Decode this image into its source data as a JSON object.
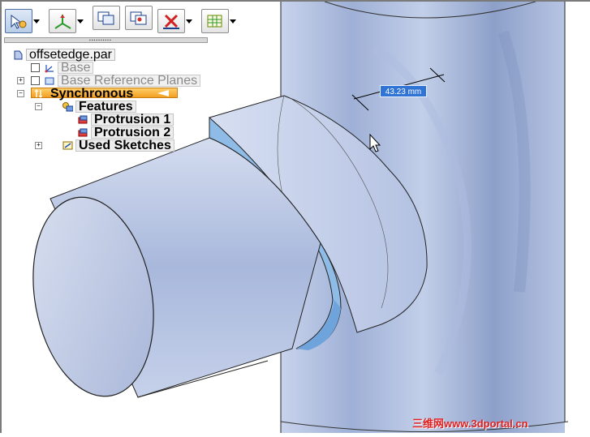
{
  "toolbar": {
    "buttons": [
      {
        "name": "select-tool",
        "active": true,
        "dropdown": true,
        "icon": "select-arrow-icon"
      },
      {
        "name": "sketch-plane",
        "active": false,
        "dropdown": true,
        "icon": "coordinate-axes-icon"
      },
      {
        "name": "view-orientation",
        "active": false,
        "dropdown": false,
        "icon": "window-stack-icon"
      },
      {
        "name": "relate-tool",
        "active": false,
        "dropdown": false,
        "icon": "relate-icon"
      },
      {
        "name": "delete-tool",
        "active": false,
        "dropdown": true,
        "icon": "red-x-icon"
      },
      {
        "name": "pattern-tool",
        "active": false,
        "dropdown": true,
        "icon": "grid-pattern-icon"
      }
    ]
  },
  "pathfinder": {
    "root": "offsetedge.par",
    "items": [
      {
        "label": "Base",
        "style": "dim"
      },
      {
        "label": "Base Reference Planes",
        "style": "dim"
      },
      {
        "label": "Synchronous",
        "style": "section"
      },
      {
        "label": "Features",
        "style": "bold"
      },
      {
        "label": "Protrusion 1",
        "style": "bold"
      },
      {
        "label": "Protrusion 2",
        "style": "bold"
      },
      {
        "label": "Used Sketches",
        "style": "bold"
      }
    ],
    "expanders": {
      "collapsed": "+",
      "expanded": "−"
    }
  },
  "dimension": {
    "value": "43.23 mm"
  },
  "watermark": "三维网www.3dportal.cn",
  "colors": {
    "accent": "#2f74d4",
    "sync_highlight": "#f3a020",
    "model_face": "#b8c6e4",
    "edge_face": "#8fb8e6"
  }
}
